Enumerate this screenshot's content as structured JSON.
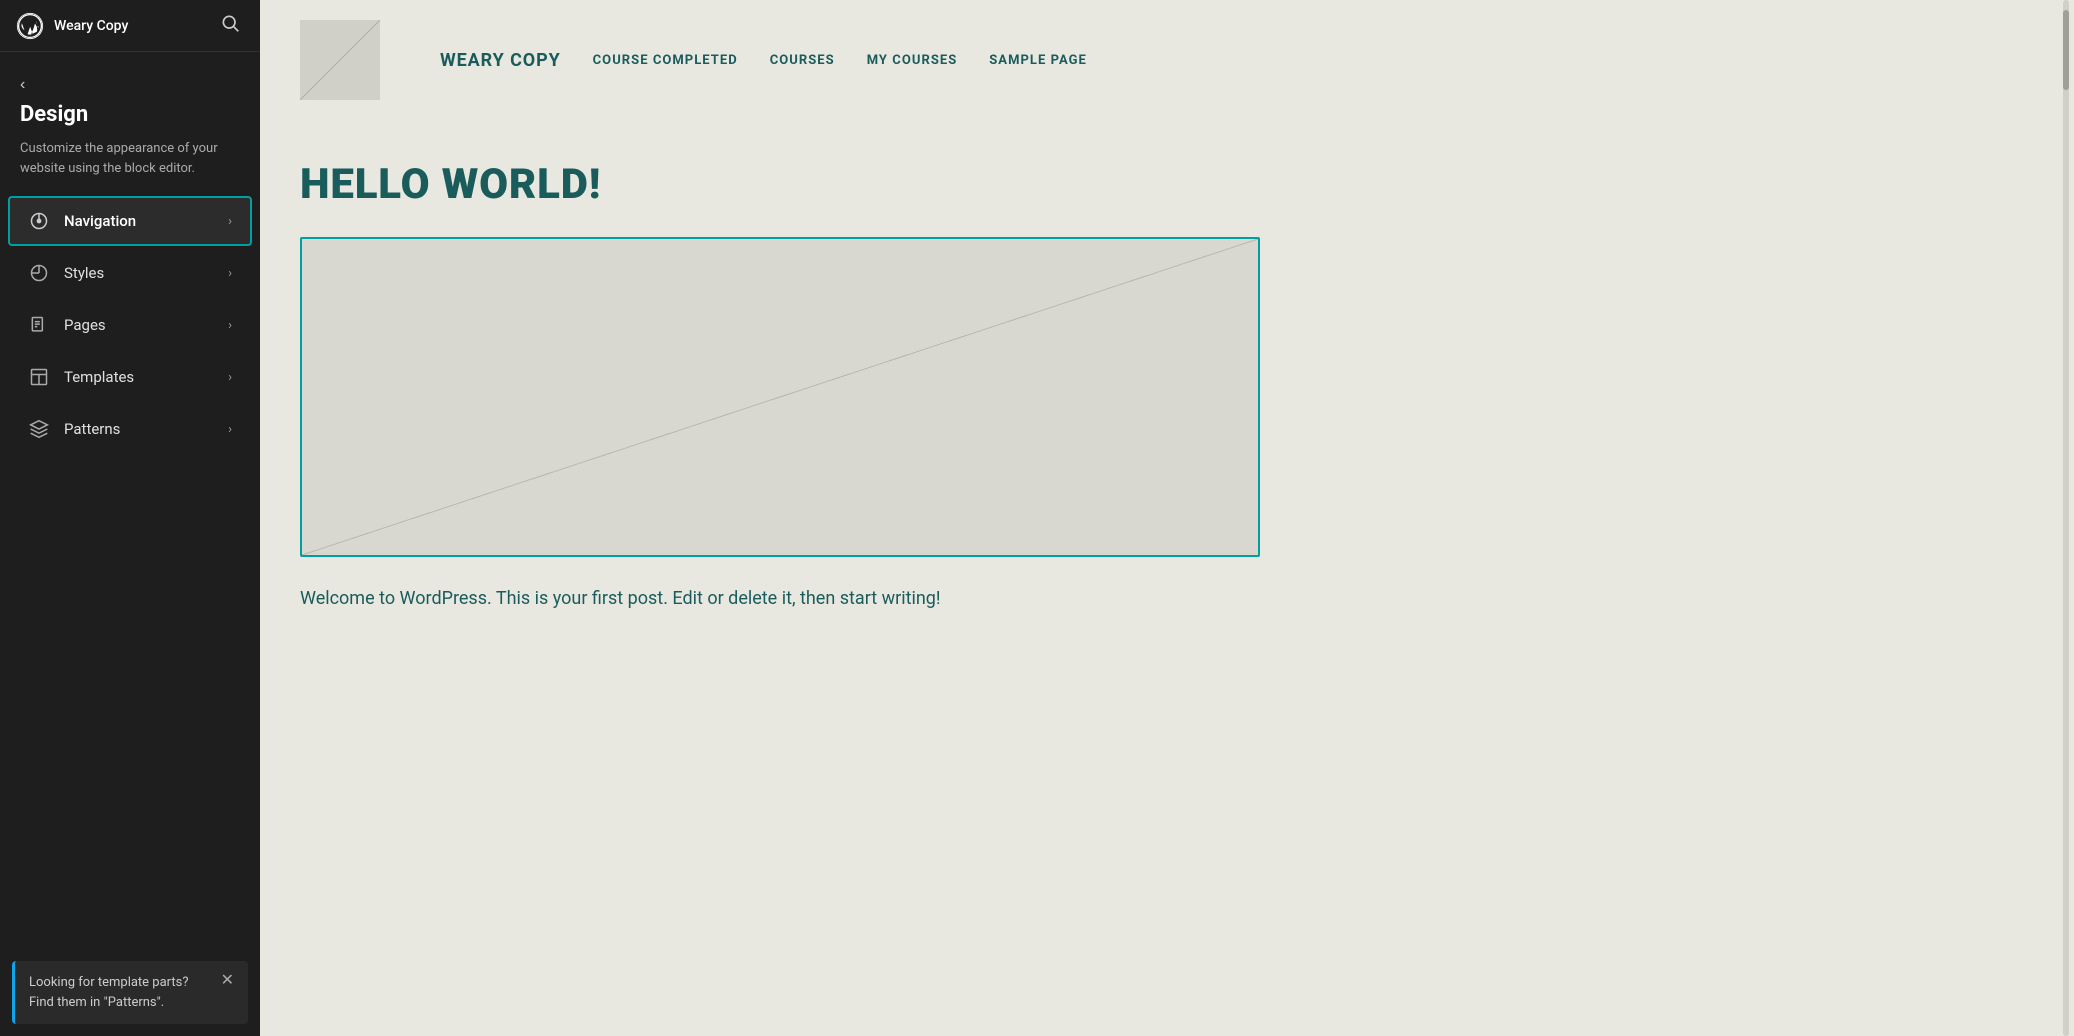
{
  "topBar": {
    "siteName": "Weary Copy",
    "searchAriaLabel": "Search"
  },
  "sidebar": {
    "backLabel": "",
    "title": "Design",
    "description": "Customize the appearance of your website using the block editor.",
    "items": [
      {
        "id": "navigation",
        "label": "Navigation",
        "icon": "navigation-icon",
        "active": true
      },
      {
        "id": "styles",
        "label": "Styles",
        "icon": "styles-icon",
        "active": false
      },
      {
        "id": "pages",
        "label": "Pages",
        "icon": "pages-icon",
        "active": false
      },
      {
        "id": "templates",
        "label": "Templates",
        "icon": "templates-icon",
        "active": false
      },
      {
        "id": "patterns",
        "label": "Patterns",
        "icon": "patterns-icon",
        "active": false
      }
    ],
    "notification": {
      "text": "Looking for template parts? Find them in \"Patterns\".",
      "closeAriaLabel": "Close notification"
    }
  },
  "preview": {
    "header": {
      "siteName": "WEARY COPY",
      "navItems": [
        "COURSE COMPLETED",
        "COURSES",
        "MY COURSES",
        "SAMPLE PAGE"
      ]
    },
    "content": {
      "heading": "HELLO WORLD!",
      "bodyText": "Welcome to WordPress. This is your first post. Edit or delete it, then start writing!"
    }
  }
}
